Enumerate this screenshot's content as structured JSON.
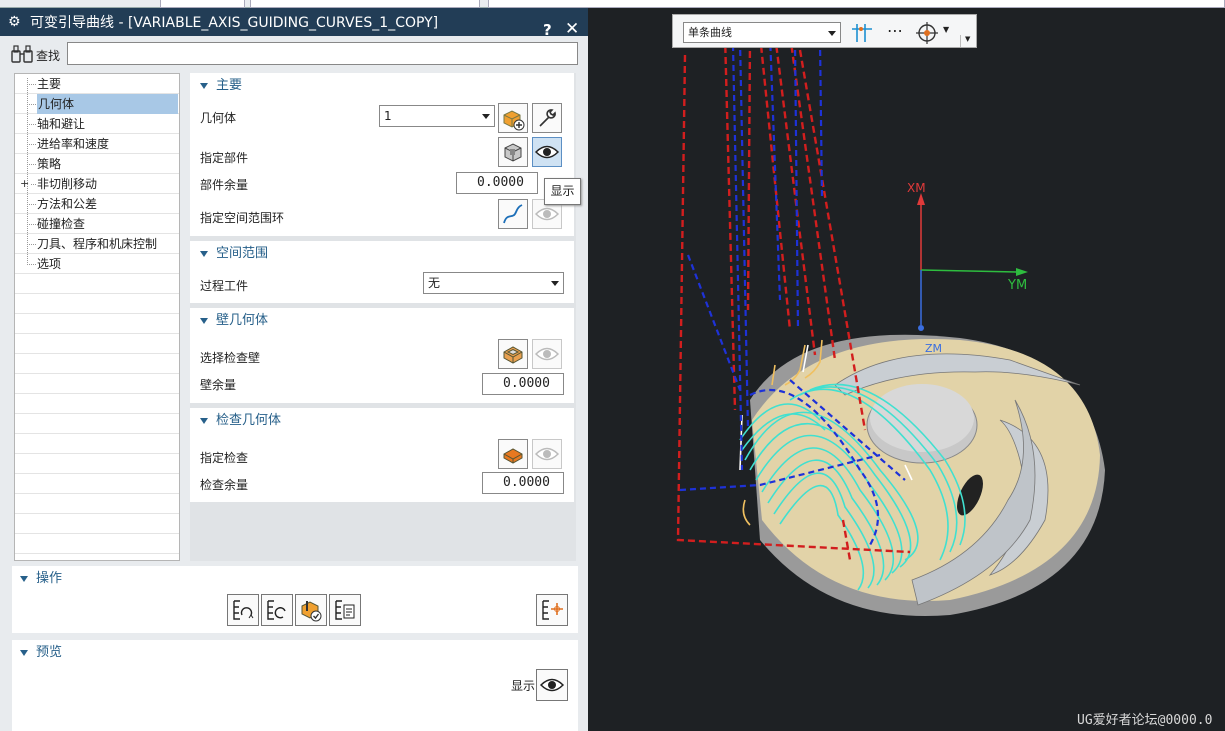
{
  "window": {
    "title": "可变引导曲线 - [VARIABLE_AXIS_GUIDING_CURVES_1_COPY]",
    "help": "?",
    "close": "✕"
  },
  "find": {
    "label": "查找",
    "value": ""
  },
  "tree": {
    "items": [
      {
        "label": "主要",
        "expandable": false
      },
      {
        "label": "几何体",
        "expandable": false,
        "selected": true
      },
      {
        "label": "轴和避让",
        "expandable": false
      },
      {
        "label": "进给率和速度",
        "expandable": false
      },
      {
        "label": "策略",
        "expandable": false
      },
      {
        "label": "非切削移动",
        "expandable": true
      },
      {
        "label": "方法和公差",
        "expandable": false
      },
      {
        "label": "碰撞检查",
        "expandable": false
      },
      {
        "label": "刀具、程序和机床控制",
        "expandable": false
      },
      {
        "label": "选项",
        "expandable": false
      }
    ]
  },
  "sections": {
    "main": {
      "title": "主要",
      "geometry_label": "几何体",
      "geometry_value": "1",
      "part_label": "指定部件",
      "part_stock_label": "部件余量",
      "part_stock_value": "0.0000",
      "boundary_label": "指定空间范围环"
    },
    "space": {
      "title": "空间范围",
      "ipw_label": "过程工件",
      "ipw_value": "无"
    },
    "wall": {
      "title": "壁几何体",
      "check_wall_label": "选择检查壁",
      "wall_stock_label": "壁余量",
      "wall_stock_value": "0.0000"
    },
    "check": {
      "title": "检查几何体",
      "specify_check_label": "指定检查",
      "check_stock_label": "检查余量",
      "check_stock_value": "0.0000"
    }
  },
  "tooltip": "显示",
  "operations": {
    "title": "操作"
  },
  "preview": {
    "title": "预览",
    "display_label": "显示"
  },
  "graphics": {
    "selection_filter": "单条曲线",
    "axes": {
      "x": "XM",
      "y": "YM",
      "z": "ZM"
    },
    "watermark": "UG爱好者论坛@0000.0"
  },
  "colors": {
    "titlebar": "#223d56",
    "accent": "#27608a",
    "viewport": "#1e2124",
    "toolpath": "#40e0d0",
    "axis_x": "#e03a3a",
    "axis_y": "#2ebd3f",
    "axis_z": "#3a6ee0"
  }
}
